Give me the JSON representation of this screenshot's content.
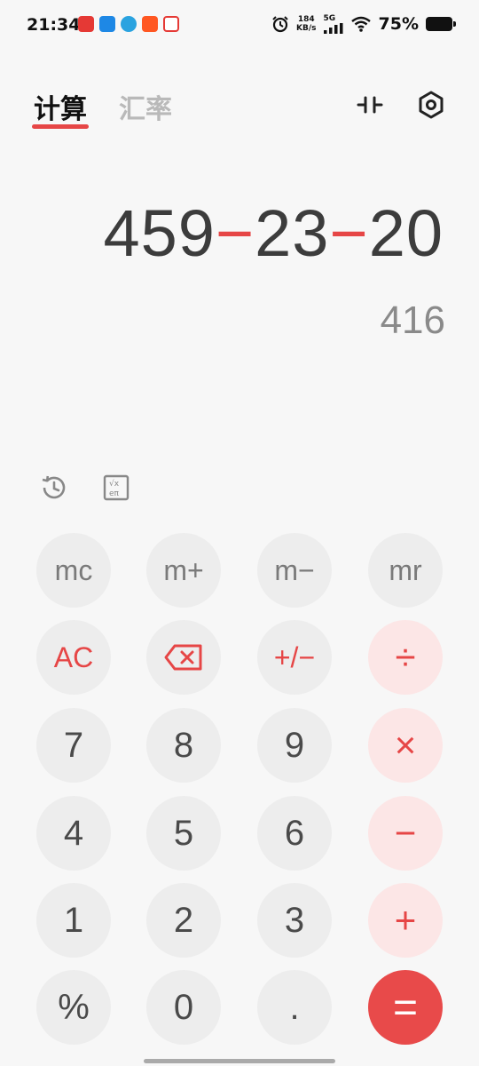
{
  "status_bar": {
    "time": "21:34",
    "net_speed_value": "184",
    "net_speed_unit": "KB/s",
    "network": "5G",
    "battery_percent": "75%"
  },
  "tabs": [
    {
      "label": "计算",
      "active": true
    },
    {
      "label": "汇率",
      "active": false
    }
  ],
  "display": {
    "expression_parts": [
      "459",
      "−",
      "23",
      "−",
      "20"
    ],
    "result": "416"
  },
  "keys": {
    "mc": "mc",
    "mplus": "m+",
    "mminus": "m−",
    "mr": "mr",
    "ac": "AC",
    "plusminus": "+/−",
    "divide": "÷",
    "k7": "7",
    "k8": "8",
    "k9": "9",
    "multiply": "×",
    "k4": "4",
    "k5": "5",
    "k6": "6",
    "minus": "−",
    "k1": "1",
    "k2": "2",
    "k3": "3",
    "plus": "+",
    "percent": "%",
    "k0": "0",
    "dot": ".",
    "equals": "="
  },
  "colors": {
    "accent": "#e64646",
    "key_bg": "#ededed",
    "op_bg": "#fce6e6"
  }
}
